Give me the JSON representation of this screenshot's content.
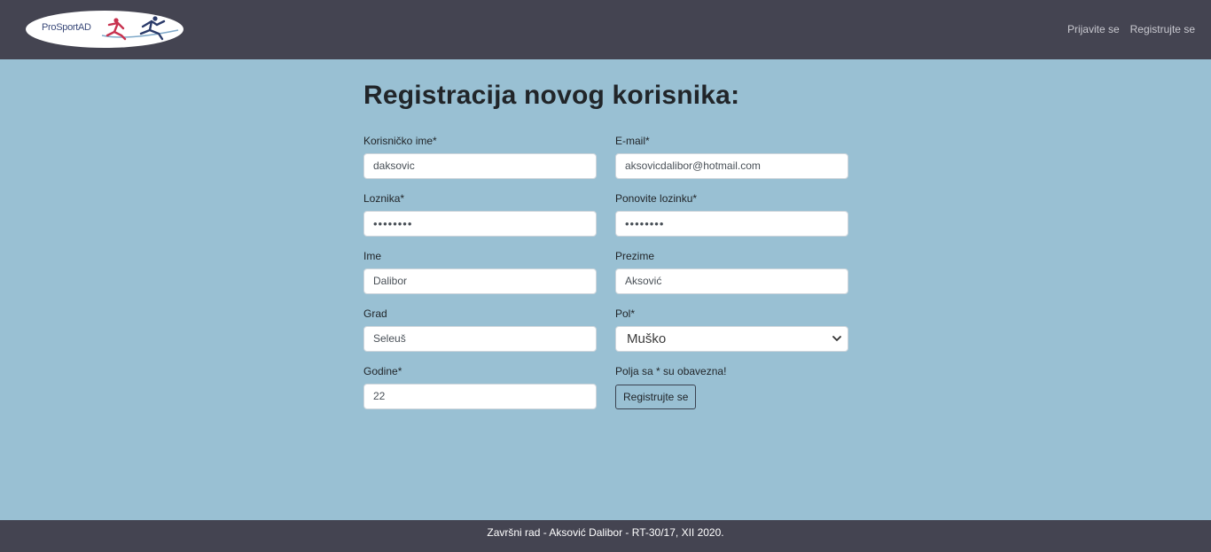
{
  "header": {
    "logo_text": "ProSportAD",
    "nav": [
      "Prijavite se",
      "Registrujte se"
    ]
  },
  "form": {
    "title": "Registracija novog korisnika:",
    "username": {
      "label": "Korisničko ime*",
      "value": "daksovic"
    },
    "email": {
      "label": "E-mail*",
      "value": "aksovicdalibor@hotmail.com"
    },
    "password": {
      "label": "Loznika*",
      "value": "••••••••"
    },
    "password_repeat": {
      "label": "Ponovite lozinku*",
      "value": "••••••••"
    },
    "first_name": {
      "label": "Ime",
      "value": "Dalibor"
    },
    "last_name": {
      "label": "Prezime",
      "value": "Aksović"
    },
    "city": {
      "label": "Grad",
      "value": "Seleuš"
    },
    "gender": {
      "label": "Pol*",
      "value": "Muško"
    },
    "age": {
      "label": "Godine*",
      "value": "22"
    },
    "required_note": "Polja sa * su obavezna!",
    "submit_label": "Registrujte se"
  },
  "footer": {
    "text": "Završni rad - Aksović Dalibor - RT-30/17, XII 2020."
  },
  "colors": {
    "navbar": "#444451",
    "background": "#99c0d3"
  }
}
